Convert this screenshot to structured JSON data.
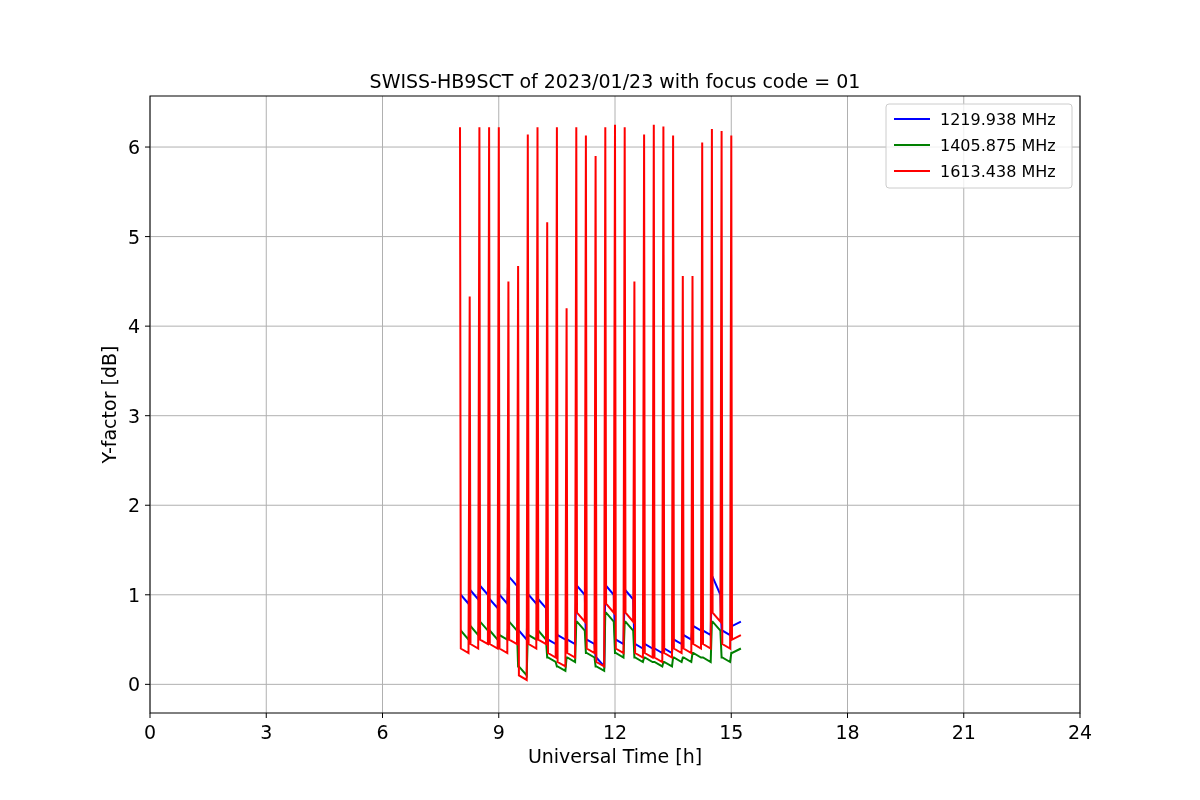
{
  "chart_data": {
    "type": "line",
    "title": "SWISS-HB9SCT of 2023/01/23 with focus code = 01",
    "xlabel": "Universal Time [h]",
    "ylabel": "Y-factor [dB]",
    "x": [
      8,
      8.02,
      8.22,
      8.25,
      8.27,
      8.47,
      8.5,
      8.52,
      8.72,
      8.75,
      8.77,
      8.97,
      9,
      9.02,
      9.22,
      9.25,
      9.27,
      9.47,
      9.5,
      9.52,
      9.72,
      9.75,
      9.77,
      9.97,
      10,
      10.02,
      10.22,
      10.25,
      10.27,
      10.47,
      10.5,
      10.52,
      10.72,
      10.75,
      10.77,
      10.97,
      11,
      11.02,
      11.22,
      11.25,
      11.27,
      11.47,
      11.5,
      11.52,
      11.72,
      11.75,
      11.77,
      11.97,
      12,
      12.02,
      12.22,
      12.25,
      12.27,
      12.47,
      12.5,
      12.52,
      12.72,
      12.75,
      12.77,
      12.97,
      13,
      13.02,
      13.22,
      13.25,
      13.27,
      13.47,
      13.5,
      13.52,
      13.72,
      13.75,
      13.77,
      13.97,
      14,
      14.02,
      14.22,
      14.25,
      14.27,
      14.47,
      14.5,
      14.52,
      14.72,
      14.75,
      14.77,
      14.97,
      15,
      15.02,
      15.25
    ],
    "series": [
      {
        "name": "1219.938 MHz",
        "color": "#0000ff",
        "values": [
          1.0,
          1.0,
          0.9,
          1.05,
          1.05,
          0.95,
          1.1,
          1.1,
          1.0,
          0.95,
          0.95,
          0.85,
          1.0,
          1.0,
          0.9,
          1.2,
          1.2,
          1.1,
          0.6,
          0.6,
          0.5,
          1.0,
          1.0,
          0.9,
          0.95,
          0.95,
          0.85,
          0.5,
          0.5,
          0.45,
          0.55,
          0.55,
          0.5,
          0.5,
          0.5,
          0.45,
          1.1,
          1.1,
          1.0,
          0.5,
          0.5,
          0.45,
          0.3,
          0.3,
          0.2,
          1.1,
          1.1,
          1.0,
          0.5,
          0.5,
          0.45,
          1.05,
          1.05,
          0.95,
          0.45,
          0.45,
          0.4,
          0.45,
          0.45,
          0.4,
          0.4,
          0.4,
          0.35,
          0.4,
          0.4,
          0.35,
          0.5,
          0.5,
          0.45,
          0.55,
          0.55,
          0.5,
          0.65,
          0.65,
          0.6,
          0.6,
          0.6,
          0.55,
          1.2,
          1.2,
          1.0,
          0.6,
          0.6,
          0.55,
          0.65,
          0.65,
          0.7
        ]
      },
      {
        "name": "1405.875 MHz",
        "color": "#008000",
        "values": [
          0.6,
          0.6,
          0.5,
          0.65,
          0.65,
          0.55,
          0.7,
          0.7,
          0.6,
          0.6,
          0.6,
          0.5,
          0.55,
          0.55,
          0.5,
          0.7,
          0.7,
          0.6,
          0.2,
          0.2,
          0.1,
          0.55,
          0.55,
          0.5,
          0.6,
          0.6,
          0.5,
          0.3,
          0.3,
          0.25,
          0.2,
          0.2,
          0.15,
          0.3,
          0.3,
          0.25,
          0.7,
          0.7,
          0.6,
          0.35,
          0.35,
          0.3,
          0.2,
          0.2,
          0.15,
          0.8,
          0.8,
          0.7,
          0.35,
          0.35,
          0.3,
          0.7,
          0.7,
          0.6,
          0.3,
          0.3,
          0.25,
          0.3,
          0.3,
          0.25,
          0.25,
          0.25,
          0.2,
          0.25,
          0.25,
          0.2,
          0.3,
          0.3,
          0.25,
          0.3,
          0.3,
          0.25,
          0.35,
          0.35,
          0.3,
          0.3,
          0.3,
          0.25,
          0.7,
          0.7,
          0.6,
          0.3,
          0.3,
          0.25,
          0.35,
          0.35,
          0.4
        ]
      },
      {
        "name": "1613.438 MHz",
        "color": "#ff0000",
        "values": [
          6.22,
          0.4,
          0.35,
          4.33,
          0.45,
          0.4,
          6.22,
          0.5,
          0.45,
          6.22,
          0.45,
          0.4,
          6.22,
          0.4,
          0.35,
          4.5,
          0.5,
          0.45,
          4.67,
          0.1,
          0.05,
          6.14,
          0.45,
          0.4,
          6.22,
          0.5,
          0.45,
          5.16,
          0.35,
          0.3,
          6.22,
          0.25,
          0.2,
          4.2,
          0.35,
          0.3,
          6.22,
          0.8,
          0.7,
          6.13,
          0.4,
          0.35,
          5.9,
          0.25,
          0.2,
          6.22,
          0.9,
          0.8,
          6.25,
          0.4,
          0.35,
          6.22,
          0.8,
          0.7,
          4.5,
          0.35,
          0.3,
          6.14,
          0.35,
          0.3,
          6.25,
          0.3,
          0.25,
          6.23,
          0.35,
          0.3,
          6.13,
          0.4,
          0.35,
          4.56,
          0.4,
          0.35,
          4.56,
          0.45,
          0.4,
          6.05,
          0.45,
          0.4,
          6.2,
          0.8,
          0.7,
          6.18,
          0.45,
          0.4,
          6.13,
          0.5,
          0.55
        ]
      }
    ],
    "xlim": [
      0,
      24
    ],
    "ylim": [
      -0.32,
      6.57
    ],
    "xticks": [
      0,
      3,
      6,
      9,
      12,
      15,
      18,
      21,
      24
    ],
    "yticks": [
      0,
      1,
      2,
      3,
      4,
      5,
      6
    ],
    "grid": true,
    "legend": true
  }
}
